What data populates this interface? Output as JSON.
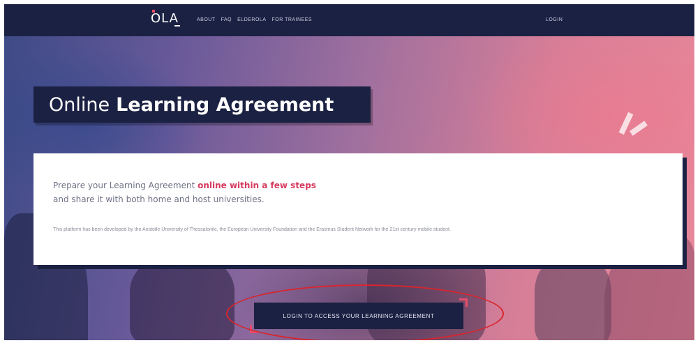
{
  "nav": {
    "logo_text": "OLA",
    "links": [
      "ABOUT",
      "FAQ",
      "ELDEROLA",
      "FOR TRAINEES"
    ],
    "login_label": "LOGIN"
  },
  "hero": {
    "title_light": "Online",
    "title_bold": "Learning Agreement"
  },
  "card": {
    "lead_prefix": "Prepare your Learning Agreement ",
    "lead_highlight": "online within a few steps",
    "lead_line2": "and share it with both home and host universities.",
    "small_text": "This platform has been developed by the Aristotle University of Thessaloniki, the European University Foundation and the Erasmus Student Network for the 21st century mobile student."
  },
  "cta": {
    "label": "LOGIN TO ACCESS YOUR LEARNING AGREEMENT"
  },
  "colors": {
    "navy": "#1b2142",
    "accent": "#e84d6b",
    "annotation_red": "#d8252e"
  }
}
